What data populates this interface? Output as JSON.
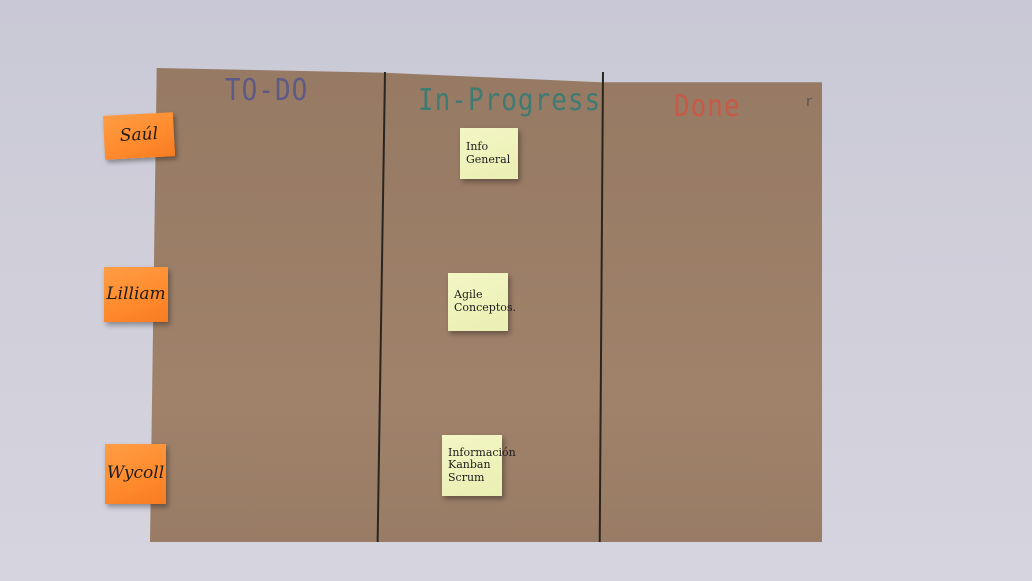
{
  "columns": [
    {
      "title": "TO-DO",
      "color": "#5e5a86"
    },
    {
      "title": "In-Progress",
      "color": "#3f7a73"
    },
    {
      "title": "Done",
      "color": "#c65a47"
    }
  ],
  "corner_mark": "r",
  "people": [
    {
      "name": "Saúl"
    },
    {
      "name": "Lilliam"
    },
    {
      "name": "Wycoll"
    }
  ],
  "tasks": [
    {
      "lines": [
        "Info",
        "General"
      ]
    },
    {
      "lines": [
        "Agile",
        "Conceptos."
      ]
    },
    {
      "lines": [
        "Información",
        "Kanban",
        "Scrum"
      ]
    }
  ],
  "colors": {
    "board": "#9a7d66",
    "wall": "#cfced9",
    "person_note": "#ff8a2c",
    "task_note": "#eef2bc"
  }
}
